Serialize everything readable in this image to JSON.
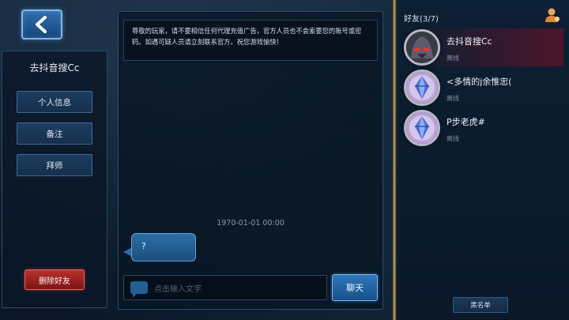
{
  "left_panel": {
    "friend_name": "去抖音搜Cc",
    "menu": [
      {
        "label": "个人信息"
      },
      {
        "label": "备注"
      },
      {
        "label": "拜师"
      }
    ],
    "delete_label": "删除好友"
  },
  "chat": {
    "notice": "尊敬的玩家，请不要相信任何代理充值广告，官方人员也不会索要您的账号或密码。如遇可疑人员请立刻联系官方。祝您游戏愉快！",
    "timestamp": "1970-01-01 00:00",
    "message": "?",
    "input_placeholder": "点击输入文字",
    "send_label": "聊天"
  },
  "friends": {
    "header": "好友(3/7)",
    "items": [
      {
        "name": "去抖音搜Cc",
        "status": "离线",
        "avatar": "dark-knight-avatar"
      },
      {
        "name": "<多情的j余惟忠(",
        "status": "离线",
        "avatar": "crystal-avatar"
      },
      {
        "name": "P步老虎#",
        "status": "离线",
        "avatar": "crystal-avatar"
      }
    ],
    "blacklist_label": "黑名单"
  }
}
